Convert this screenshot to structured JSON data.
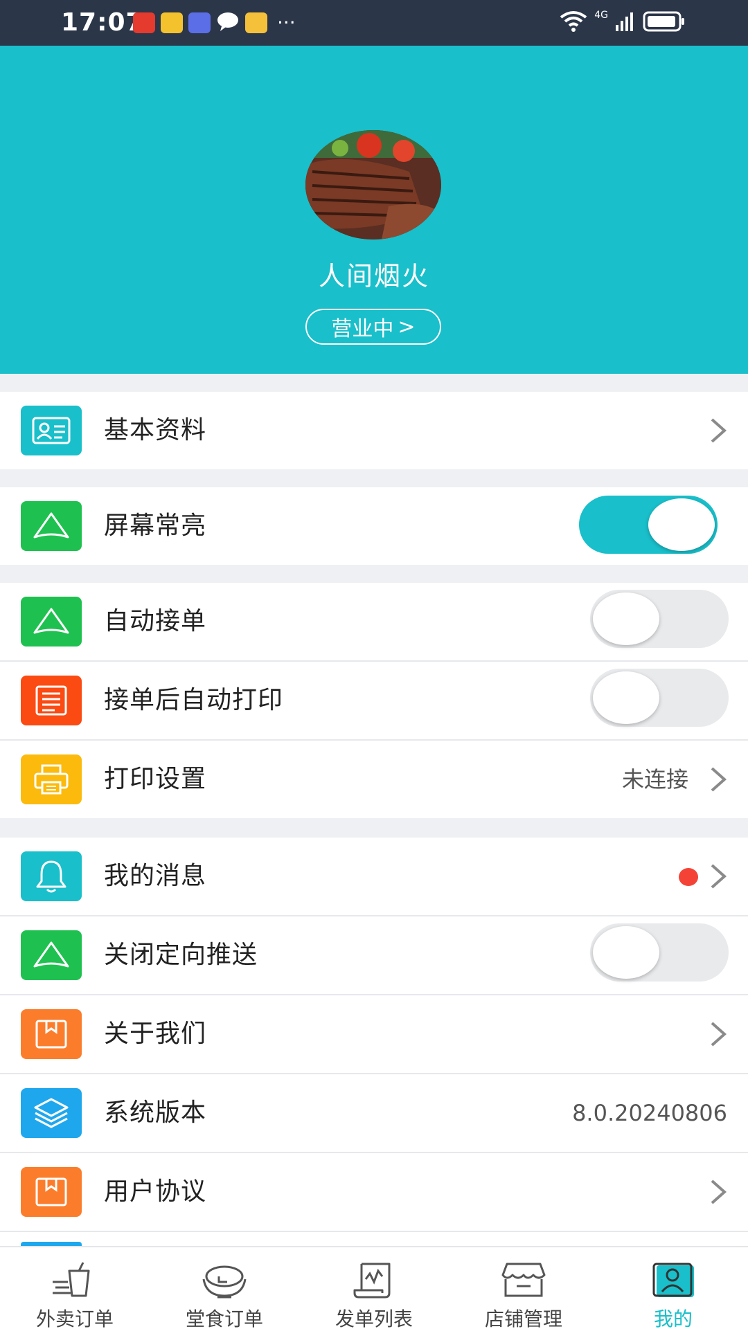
{
  "status_bar": {
    "time": "17:07",
    "network": "4G",
    "more": "···"
  },
  "header": {
    "shop_name": "人间烟火",
    "status_label": "营业中",
    "status_chevron": ">",
    "background_color": "#19bfca"
  },
  "menu": {
    "basic_info": {
      "label": "基本资料",
      "icon": "id-card-icon"
    },
    "screen_on": {
      "label": "屏幕常亮",
      "icon": "app-logo-icon",
      "toggled": true
    },
    "auto_accept": {
      "label": "自动接单",
      "icon": "app-logo-icon",
      "toggled": false
    },
    "auto_print": {
      "label": "接单后自动打印",
      "icon": "receipt-icon",
      "toggled": false
    },
    "print_settings": {
      "label": "打印设置",
      "value": "未连接",
      "icon": "printer-icon"
    },
    "my_messages": {
      "label": "我的消息",
      "icon": "bell-icon",
      "has_unread": true
    },
    "targeted_push_off": {
      "label": "关闭定向推送",
      "icon": "app-logo-icon",
      "toggled": false
    },
    "about_us": {
      "label": "关于我们",
      "icon": "box-icon"
    },
    "system_version": {
      "label": "系统版本",
      "value": "8.0.20240806",
      "icon": "layers-icon"
    },
    "user_agreement": {
      "label": "用户协议",
      "icon": "box-icon"
    }
  },
  "bottom_nav": {
    "items": [
      {
        "label": "外卖订单",
        "icon": "takeout-cup-icon",
        "active": false
      },
      {
        "label": "堂食订单",
        "icon": "rice-bowl-icon",
        "active": false
      },
      {
        "label": "发单列表",
        "icon": "list-scroll-icon",
        "active": false
      },
      {
        "label": "店铺管理",
        "icon": "store-icon",
        "active": false
      },
      {
        "label": "我的",
        "icon": "profile-icon",
        "active": true
      }
    ]
  },
  "colors": {
    "accent": "#19bfca",
    "green": "#1ec14f",
    "red_orange": "#fb4a12",
    "yellow": "#fbba0c",
    "orange": "#fb7d2c",
    "blue": "#1fa7ee",
    "unread_dot": "#f44336"
  }
}
